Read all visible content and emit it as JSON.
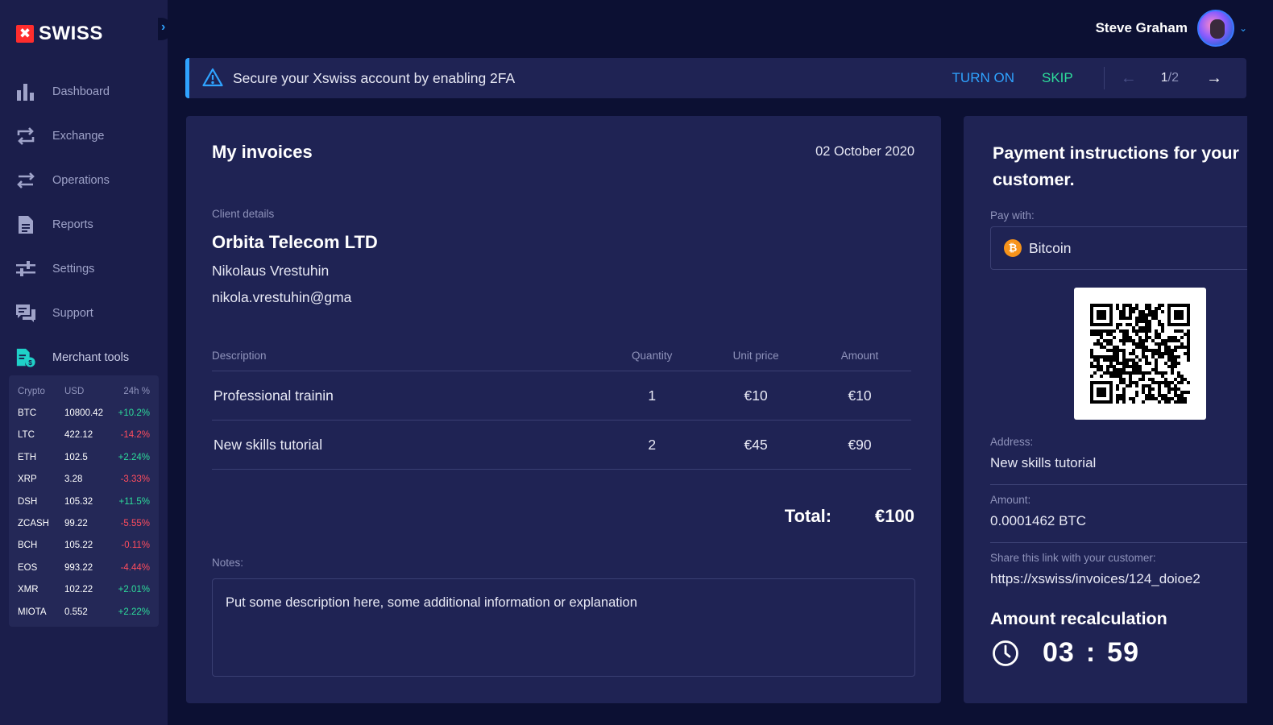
{
  "brand": {
    "logo_mark": "✖",
    "name": "SWISS"
  },
  "sidebar": {
    "items": [
      {
        "label": "Dashboard",
        "icon": "bar-chart-icon"
      },
      {
        "label": "Exchange",
        "icon": "exchange-icon"
      },
      {
        "label": "Operations",
        "icon": "arrows-icon"
      },
      {
        "label": "Reports",
        "icon": "document-icon"
      },
      {
        "label": "Settings",
        "icon": "sliders-icon"
      },
      {
        "label": "Support",
        "icon": "chat-icon"
      },
      {
        "label": "Merchant tools",
        "icon": "merchant-icon"
      }
    ],
    "ticker": {
      "headers": [
        "Crypto",
        "USD",
        "24h %"
      ],
      "rows": [
        {
          "crypto": "BTC",
          "usd": "10800.42",
          "change": "+10.2%"
        },
        {
          "crypto": "LTC",
          "usd": "422.12",
          "change": "-14.2%"
        },
        {
          "crypto": "ETH",
          "usd": "102.5",
          "change": "+2.24%"
        },
        {
          "crypto": "XRP",
          "usd": "3.28",
          "change": "-3.33%"
        },
        {
          "crypto": "DSH",
          "usd": "105.32",
          "change": "+11.5%"
        },
        {
          "crypto": "ZCASH",
          "usd": "99.22",
          "change": "-5.55%"
        },
        {
          "crypto": "BCH",
          "usd": "105.22",
          "change": "-0.11%"
        },
        {
          "crypto": "EOS",
          "usd": "993.22",
          "change": "-4.44%"
        },
        {
          "crypto": "XMR",
          "usd": "102.22",
          "change": "+2.01%"
        },
        {
          "crypto": "MIOTA",
          "usd": "0.552",
          "change": "+2.22%"
        }
      ]
    }
  },
  "header": {
    "user_name": "Steve Graham"
  },
  "banner": {
    "text": "Secure your Xswiss account by enabling 2FA",
    "turn_on": "TURN ON",
    "skip": "SKIP",
    "page_current": "1",
    "page_total": "/2"
  },
  "invoice": {
    "title": "My invoices",
    "date": "02 October 2020",
    "client_label": "Client details",
    "company": "Orbita Telecom LTD",
    "contact": "Nikolaus Vrestuhin",
    "email": "nikola.vrestuhin@gma",
    "columns": {
      "description": "Description",
      "quantity": "Quantity",
      "unit_price": "Unit price",
      "amount": "Amount"
    },
    "rows": [
      {
        "description": "Professional trainin",
        "quantity": "1",
        "unit_price": "€10",
        "amount": "€10"
      },
      {
        "description": "New skills tutorial",
        "quantity": "2",
        "unit_price": "€45",
        "amount": "€90"
      }
    ],
    "total_label": "Total:",
    "total_value": "€100",
    "notes_label": "Notes:",
    "notes_text": "Put some description here, some additional information or explanation"
  },
  "payment": {
    "title": "Payment instructions for your customer.",
    "pay_with_label": "Pay with:",
    "pay_with_value": "Bitcoin",
    "btc_symbol": "₿",
    "address_label": "Address:",
    "address_value": "New skills tutorial",
    "amount_label": "Amount:",
    "amount_value": "0.0001462 BTC",
    "share_label": "Share this link with your customer:",
    "share_value": "https://xswiss/invoices/124_doioe2",
    "recalc_title": "Amount recalculation",
    "timer_min": "03",
    "timer_sep": ":",
    "timer_sec": "59"
  },
  "colors": {
    "accent_blue": "#2fa3ff",
    "accent_green": "#2ddc9b",
    "negative_red": "#ff4d5e",
    "brand_red": "#ff2d2d"
  }
}
